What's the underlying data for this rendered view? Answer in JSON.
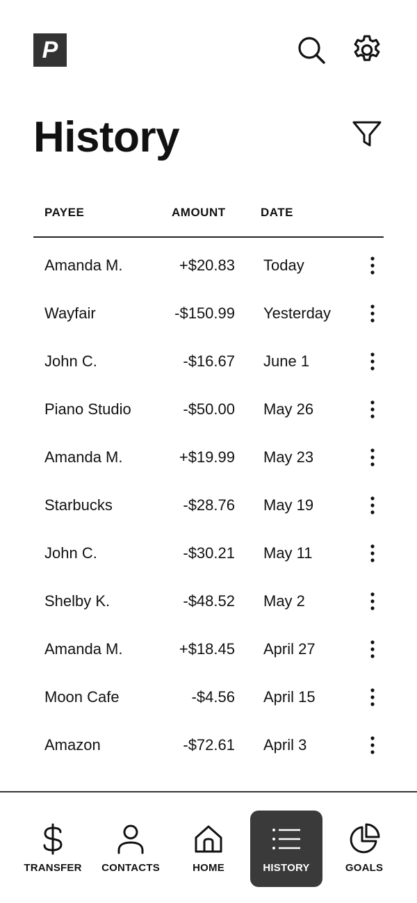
{
  "header": {
    "logo_letter": "P",
    "title": "History"
  },
  "table": {
    "columns": {
      "payee": "PAYEE",
      "amount": "AMOUNT",
      "date": "DATE"
    },
    "rows": [
      {
        "payee": "Amanda M.",
        "amount": "+$20.83",
        "date": "Today"
      },
      {
        "payee": "Wayfair",
        "amount": "-$150.99",
        "date": "Yesterday"
      },
      {
        "payee": "John C.",
        "amount": "-$16.67",
        "date": "June 1"
      },
      {
        "payee": "Piano Studio",
        "amount": "-$50.00",
        "date": "May 26"
      },
      {
        "payee": "Amanda M.",
        "amount": "+$19.99",
        "date": "May 23"
      },
      {
        "payee": "Starbucks",
        "amount": "-$28.76",
        "date": "May 19"
      },
      {
        "payee": "John C.",
        "amount": "-$30.21",
        "date": "May 11"
      },
      {
        "payee": "Shelby K.",
        "amount": "-$48.52",
        "date": "May 2"
      },
      {
        "payee": "Amanda M.",
        "amount": "+$18.45",
        "date": "April 27"
      },
      {
        "payee": "Moon Cafe",
        "amount": "-$4.56",
        "date": "April 15"
      },
      {
        "payee": "Amazon",
        "amount": "-$72.61",
        "date": "April 3"
      }
    ]
  },
  "nav": {
    "transfer": "TRANSFER",
    "contacts": "CONTACTS",
    "home": "HOME",
    "history": "HISTORY",
    "goals": "GOALS",
    "active": "history"
  },
  "icons": {
    "logo": "logo-icon",
    "search": "search-icon",
    "settings": "gear-icon",
    "filter": "filter-icon",
    "more": "more-vertical-icon",
    "transfer": "dollar-icon",
    "contacts": "person-icon",
    "home": "home-icon",
    "history": "list-icon",
    "goals": "pie-chart-icon"
  },
  "colors": {
    "text": "#111111",
    "active_nav_bg": "#3a3a3a",
    "logo_bg": "#333333"
  }
}
